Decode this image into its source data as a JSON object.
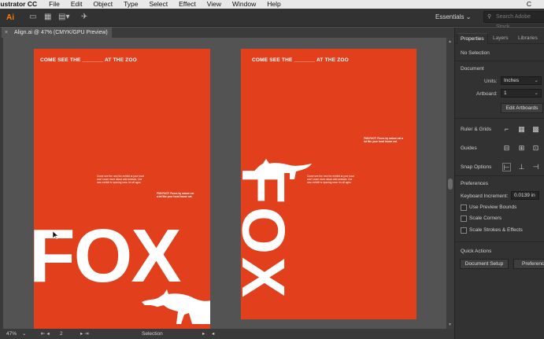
{
  "menubar": {
    "app_name": "lustrator CC",
    "items": [
      "File",
      "Edit",
      "Object",
      "Type",
      "Select",
      "Effect",
      "View",
      "Window",
      "Help"
    ],
    "tail": "C"
  },
  "toolbar": {
    "logo": "Ai",
    "workspace": "Essentials",
    "search_placeholder": "Search Adobe Stock"
  },
  "document_tab": {
    "title": "Align.ai @ 47% (CMYK/GPU Preview)"
  },
  "artboards": [
    {
      "headline": "COME SEE THE _______ AT THE ZOO",
      "body_text": "Come see the new fox exhibit at your local zoo! Learn more about wild animals. Our new exhibit is opening soon for all ages.",
      "fun_fact": "FUN FACT: Foxes by nature eat a lot like your local house cat.",
      "big_word": "FOX"
    },
    {
      "headline": "COME SEE THE _______ AT THE ZOO",
      "body_text": "Come see the new fox exhibit at your local zoo! Learn more about wild animals. Our new exhibit is opening soon for all ages.",
      "fun_fact": "FUN FACT: Foxes by nature eat a lot like your local house cat.",
      "big_word": "FOX"
    }
  ],
  "statusbar": {
    "zoom": "47%",
    "artboard_nav": "2",
    "tool": "Selection"
  },
  "panel": {
    "tabs": [
      "Properties",
      "Layers",
      "Libraries"
    ],
    "selection": "No Selection",
    "document_heading": "Document",
    "units_label": "Units:",
    "units_value": "Inches",
    "artboard_label": "Artboard:",
    "artboard_value": "1",
    "edit_artboards": "Edit Artboards",
    "ruler_grids": "Ruler & Grids",
    "guides": "Guides",
    "snap_options": "Snap Options",
    "preferences_heading": "Preferences",
    "keyboard_increment_label": "Keyboard Increment:",
    "keyboard_increment_value": "0.0139 in",
    "use_preview_bounds": "Use Preview Bounds",
    "scale_corners": "Scale Corners",
    "scale_strokes_effects": "Scale Strokes & Effects",
    "quick_actions": "Quick Actions",
    "document_setup": "Document Setup",
    "preferences_button": "Preferences"
  },
  "colors": {
    "artboard": "#e2401d",
    "ui_dark": "#323232",
    "canvas": "#535353"
  }
}
